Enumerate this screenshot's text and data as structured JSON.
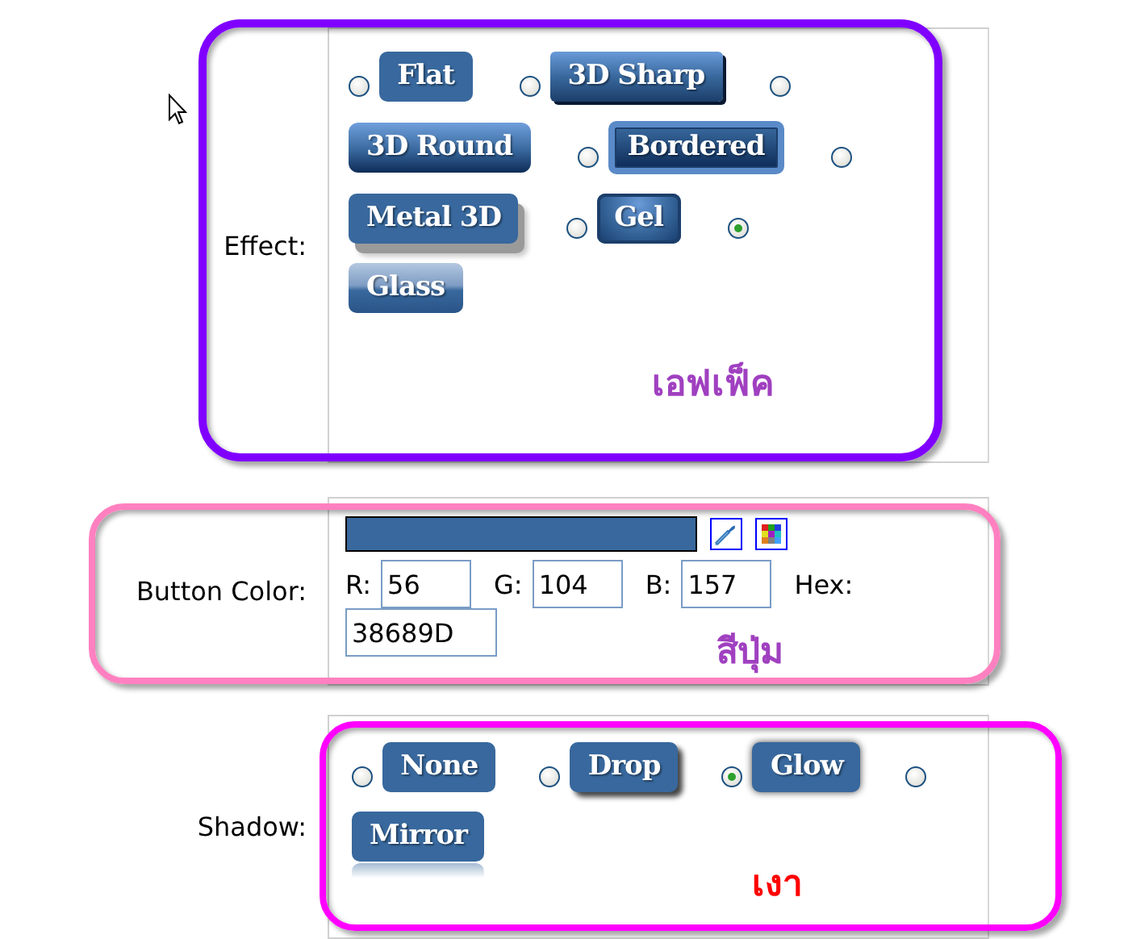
{
  "effect": {
    "label": "Effect:",
    "options": [
      {
        "label": "Flat",
        "kind": "flat",
        "selected": false
      },
      {
        "label": "3D Sharp",
        "kind": "sharp",
        "selected": false
      },
      {
        "label": "3D Round",
        "kind": "round",
        "selected": false
      },
      {
        "label": "Bordered",
        "kind": "bordered",
        "selected": false
      },
      {
        "label": "Metal 3D",
        "kind": "metal",
        "selected": false
      },
      {
        "label": "Gel",
        "kind": "gel",
        "selected": false
      },
      {
        "label": "Glass",
        "kind": "glass",
        "selected": true
      }
    ],
    "annotation": {
      "text": "เอฟเฟ็ค",
      "color": "#8000ff"
    }
  },
  "button_color": {
    "label": "Button Color:",
    "fields": [
      {
        "label": "R:",
        "value": "56"
      },
      {
        "label": "G:",
        "value": "104"
      },
      {
        "label": "B:",
        "value": "157"
      }
    ],
    "hex_label": "Hex:",
    "hex": "38689D",
    "annotation": {
      "text": "สีปุ่ม",
      "color": "#ff80c0"
    }
  },
  "shadow": {
    "label": "Shadow:",
    "options": [
      {
        "label": "None",
        "kind": "none",
        "selected": false
      },
      {
        "label": "Drop",
        "kind": "drop",
        "selected": false
      },
      {
        "label": "Glow",
        "kind": "glow",
        "selected": true
      },
      {
        "label": "Mirror",
        "kind": "mirror",
        "selected": false
      }
    ],
    "annotation": {
      "text": "เงา",
      "color": "#ff00ff"
    }
  }
}
